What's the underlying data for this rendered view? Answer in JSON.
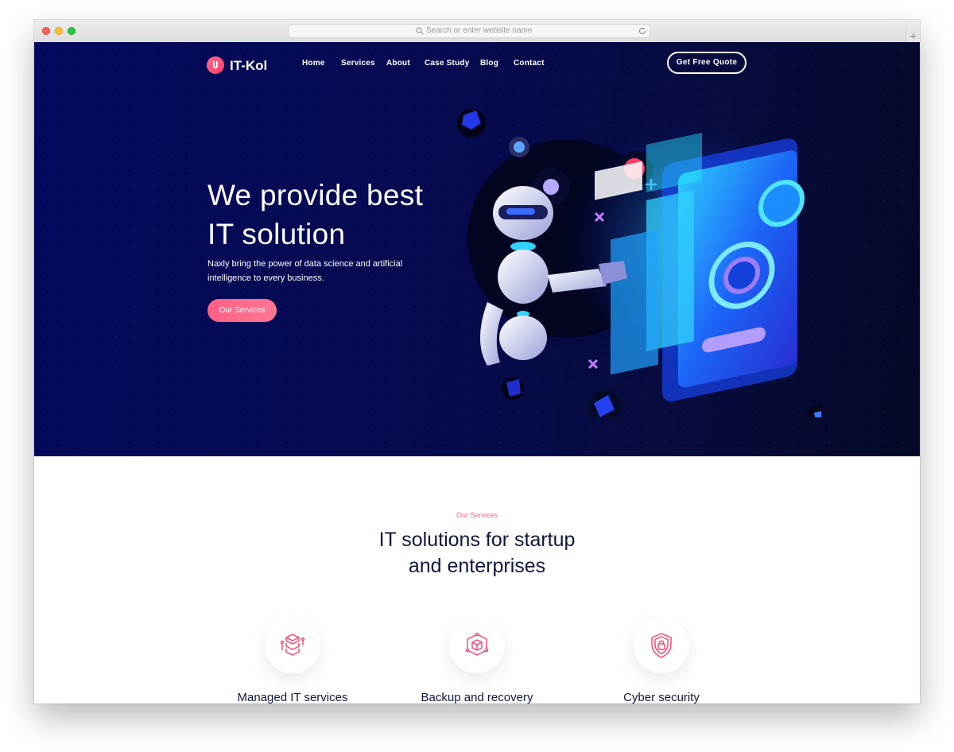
{
  "browser": {
    "url_placeholder": "Search or enter website name",
    "newtab_label": "+"
  },
  "header": {
    "logo_text": "IT-Kol",
    "nav": [
      "Home",
      "Services",
      "About",
      "Case Study",
      "Blog",
      "Contact"
    ],
    "quote_button": "Get Free Quote"
  },
  "hero": {
    "headline_line1": "We provide best",
    "headline_line2": "IT solution",
    "subtext_line1": "Naxly bring the power of data science and artificial",
    "subtext_line2": "intelligence to every business.",
    "cta_label": "Our Services",
    "illustration_icon": "robot-dashboard-illustration"
  },
  "services": {
    "kicker": "Our Services",
    "title_line1": "IT solutions for startup",
    "title_line2": "and enterprises",
    "items": [
      {
        "title": "Managed IT services",
        "icon": "server-stack-icon"
      },
      {
        "title": "Backup and recovery",
        "icon": "cube-network-icon"
      },
      {
        "title": "Cyber security",
        "icon": "shield-lock-icon"
      }
    ]
  },
  "colors": {
    "accent": "#ff5d7d",
    "hero_bg": "#05095a",
    "heading": "#10173f"
  }
}
